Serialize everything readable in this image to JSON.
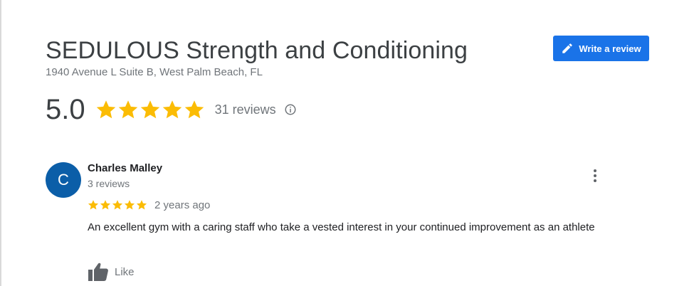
{
  "business": {
    "name": "SEDULOUS Strength and Conditioning",
    "address": "1940 Avenue L Suite B, West Palm Beach, FL"
  },
  "write_review": {
    "label": "Write a review",
    "icon": "pencil-icon"
  },
  "summary": {
    "rating": "5.0",
    "stars": 5,
    "reviews_label": "31 reviews",
    "info_icon": "info-icon"
  },
  "review": {
    "avatar_letter": "C",
    "reviewer_name": "Charles Malley",
    "reviewer_reviews": "3 reviews",
    "stars": 5,
    "date": "2 years ago",
    "text": "An excellent gym with a caring staff who take a vested interest in your continued improvement as an athlete",
    "like_label": "Like",
    "more_icon": "more-vert-icon"
  },
  "colors": {
    "star": "#fbbc04",
    "primary_button": "#1a73e8",
    "avatar": "#0b5ea8",
    "muted_text": "#70757a"
  }
}
